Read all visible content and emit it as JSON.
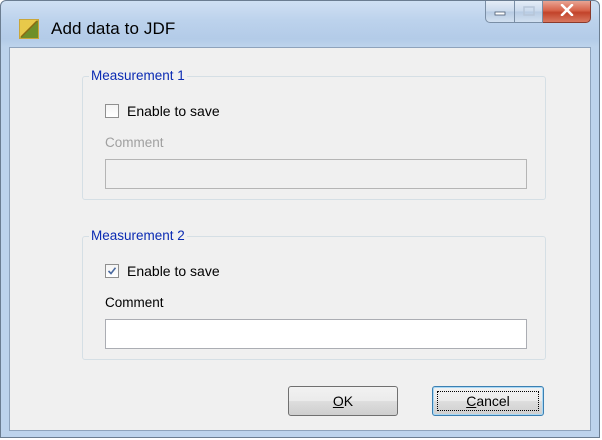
{
  "window": {
    "title": "Add data to JDF",
    "icon": "jdf-app-icon"
  },
  "caption": {
    "minimize_icon": "minimize-icon",
    "maximize_icon": "maximize-icon",
    "close_icon": "close-icon"
  },
  "measurement1": {
    "legend": "Measurement 1",
    "enable_label": "Enable to save",
    "enable_checked": false,
    "comment_label": "Comment",
    "comment_value": "",
    "enabled": false
  },
  "measurement2": {
    "legend": "Measurement 2",
    "enable_label": "Enable to save",
    "enable_checked": true,
    "comment_label": "Comment",
    "comment_value": "",
    "enabled": true
  },
  "buttons": {
    "ok_accel": "O",
    "ok_rest": "K",
    "cancel_accel": "C",
    "cancel_rest": "ancel"
  },
  "colors": {
    "group_legend": "#0b2bb3",
    "close_button": "#c2432a"
  }
}
